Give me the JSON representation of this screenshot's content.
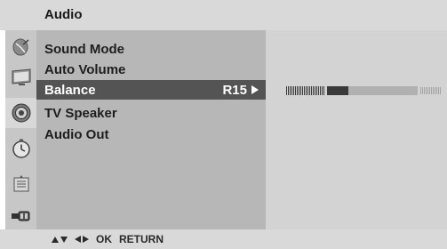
{
  "menu": {
    "title": "Audio",
    "items": [
      {
        "label": "Sound Mode",
        "value": "",
        "selected": false
      },
      {
        "label": "Auto Volume",
        "value": "",
        "selected": false
      },
      {
        "label": "Balance",
        "value": "R15",
        "selected": true
      },
      {
        "label": "TV Speaker",
        "value": "",
        "selected": false
      },
      {
        "label": "Audio Out",
        "value": "",
        "selected": false
      }
    ]
  },
  "side_icons": [
    {
      "name": "satellite-dish-icon",
      "active": false
    },
    {
      "name": "screen-icon",
      "active": false
    },
    {
      "name": "speaker-icon",
      "active": true
    },
    {
      "name": "clock-icon",
      "active": false
    },
    {
      "name": "lock-icon",
      "active": false
    },
    {
      "name": "input-plug-icon",
      "active": false
    }
  ],
  "balance": {
    "min": -50,
    "max": 50,
    "value": 15,
    "indicator_color": "#3a3a3a"
  },
  "footer": {
    "ok_label": "OK",
    "return_label": "RETURN"
  },
  "colors": {
    "selected_row": "#545454",
    "menu_bg": "#b7b7b7",
    "value_bg": "#d3d3d3",
    "header_bg": "#d9d9d9"
  }
}
